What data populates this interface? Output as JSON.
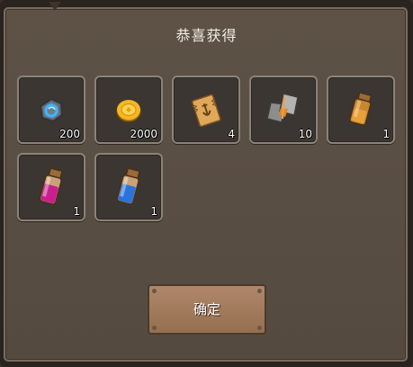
{
  "dialog": {
    "title": "恭喜获得",
    "confirm_label": "确定"
  },
  "rewards": [
    {
      "icon": "blue-gem-coin-icon",
      "qty": "200"
    },
    {
      "icon": "gold-coin-icon",
      "qty": "2000"
    },
    {
      "icon": "scroll-ticket-icon",
      "qty": "4"
    },
    {
      "icon": "paper-fragment-icon",
      "qty": "10"
    },
    {
      "icon": "orange-potion-bottle-icon",
      "qty": "1"
    },
    {
      "icon": "magenta-potion-bottle-icon",
      "qty": "1"
    },
    {
      "icon": "blue-potion-bottle-icon",
      "qty": "1"
    }
  ],
  "colors": {
    "panel": "#5a4f45",
    "slot": "#3b3631",
    "button": "#a27a5d"
  }
}
